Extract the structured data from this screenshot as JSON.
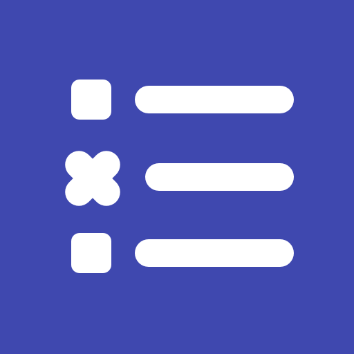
{
  "icon": {
    "name": "checklist-icon",
    "background_color": "#3F48AF",
    "glyph_color": "#FFFFFF",
    "items": [
      {
        "marker": "square",
        "icon": "checkbox-square-icon"
      },
      {
        "marker": "cross",
        "icon": "cross-mark-icon"
      },
      {
        "marker": "square",
        "icon": "checkbox-square-icon"
      }
    ]
  }
}
